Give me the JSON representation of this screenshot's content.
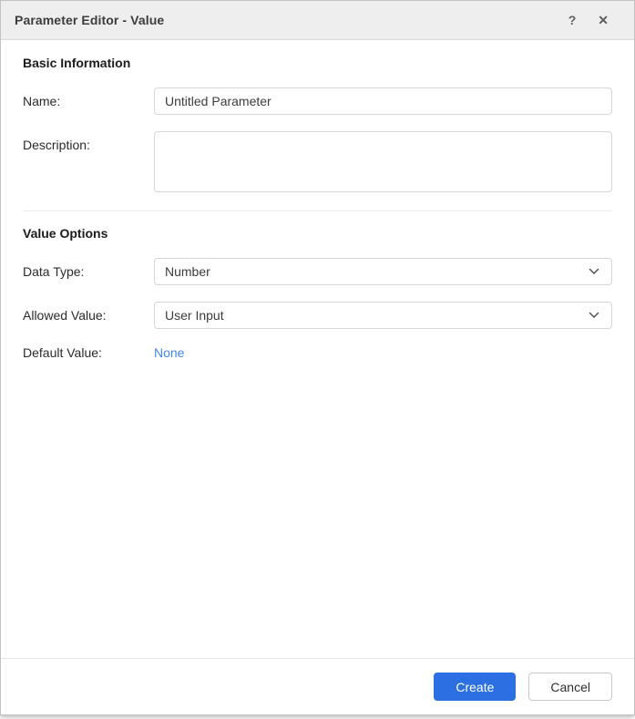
{
  "dialog": {
    "title": "Parameter Editor - Value",
    "help_icon": "?",
    "close_icon": "✕"
  },
  "sections": {
    "basic_information": {
      "heading": "Basic Information"
    },
    "value_options": {
      "heading": "Value Options"
    }
  },
  "fields": {
    "name": {
      "label": "Name:",
      "value": "Untitled Parameter"
    },
    "description": {
      "label": "Description:",
      "value": ""
    },
    "data_type": {
      "label": "Data Type:",
      "value": "Number"
    },
    "allowed_value": {
      "label": "Allowed Value:",
      "value": "User Input"
    },
    "default_value": {
      "label": "Default Value:",
      "value": "None",
      "link_color": "#4285f4"
    }
  },
  "footer": {
    "create_label": "Create",
    "cancel_label": "Cancel",
    "create_color": "#2b6fe2"
  }
}
